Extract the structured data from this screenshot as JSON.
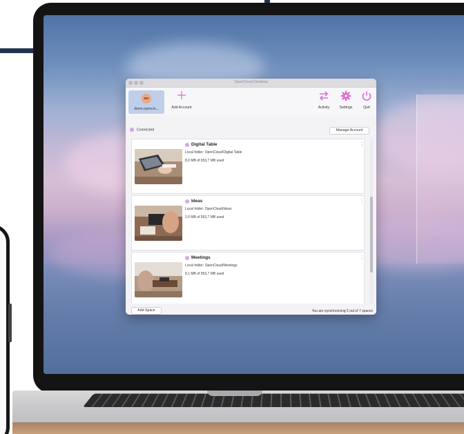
{
  "window": {
    "title": "OpenCloud Desktop"
  },
  "toolbar": {
    "account": {
      "initials": "MH",
      "name": "demo.openclo..."
    },
    "add_account": "Add Account",
    "activity": "Activity",
    "settings": "Settings",
    "quit": "Quit"
  },
  "status": {
    "label": "Connected"
  },
  "manage_account": "Manage Account",
  "spaces": [
    {
      "name": "Digital Table",
      "folder": "Local folder: OpenCloud/Digital Table",
      "usage": "8,0 MB of 953,7 MB used"
    },
    {
      "name": "Ideas",
      "folder": "Local folder: OpenCloud/Ideas",
      "usage": "2,0 MB of 953,7 MB used"
    },
    {
      "name": "Meetings",
      "folder": "Local folder: OpenCloud/Meetings",
      "usage": "8,1 MB of 953,7 MB used"
    }
  ],
  "footer": {
    "add_space": "Add Space",
    "sync_status": "You are synchronizing 5 out of 7 spaces"
  },
  "colors": {
    "accent": "#e06ad6",
    "account_tile": "#bfcfe9",
    "status_dot": "#c9a6e6"
  },
  "icons": {
    "add_account": "plus-icon",
    "activity": "sync-arrows-icon",
    "settings": "gear-icon",
    "quit": "power-icon",
    "space_menu": "kebab-menu-icon"
  }
}
